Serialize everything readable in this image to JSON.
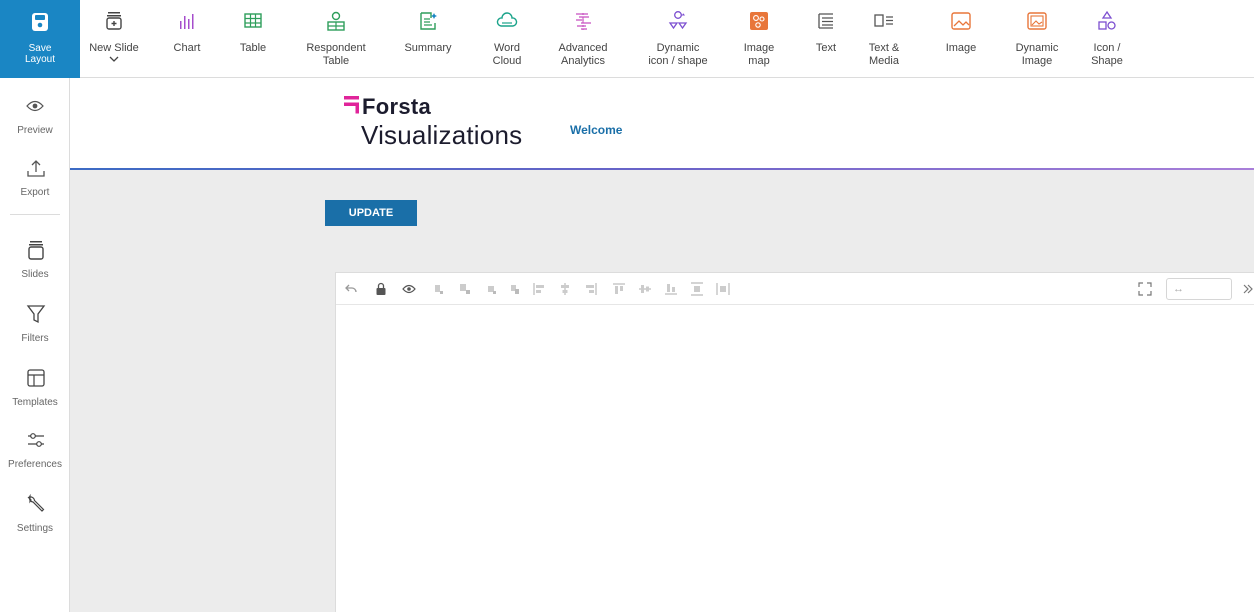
{
  "toolbar": {
    "save_label": "Save\nLayout",
    "items": [
      {
        "label": "New Slide",
        "icon": "new-slide-icon"
      },
      {
        "label": "Chart",
        "icon": "chart-icon"
      },
      {
        "label": "Table",
        "icon": "table-icon"
      },
      {
        "label": "Respondent\nTable",
        "icon": "respondent-table-icon"
      },
      {
        "label": "Summary",
        "icon": "summary-icon"
      },
      {
        "label": "Word\nCloud",
        "icon": "word-cloud-icon"
      },
      {
        "label": "Advanced\nAnalytics",
        "icon": "advanced-analytics-icon"
      },
      {
        "label": "Dynamic\nicon / shape",
        "icon": "dynamic-shape-icon"
      },
      {
        "label": "Image\nmap",
        "icon": "image-map-icon"
      },
      {
        "label": "Text",
        "icon": "text-icon"
      },
      {
        "label": "Text &\nMedia",
        "icon": "text-media-icon"
      },
      {
        "label": "Image",
        "icon": "image-icon"
      },
      {
        "label": "Dynamic\nImage",
        "icon": "dynamic-image-icon"
      },
      {
        "label": "Icon /\nShape",
        "icon": "icon-shape-icon"
      }
    ]
  },
  "sidebar": {
    "items": [
      {
        "label": "Preview",
        "icon": "eye-icon"
      },
      {
        "label": "Export",
        "icon": "export-icon"
      },
      {
        "label": "Slides",
        "icon": "slides-icon"
      },
      {
        "label": "Filters",
        "icon": "filter-icon"
      },
      {
        "label": "Templates",
        "icon": "templates-icon"
      },
      {
        "label": "Preferences",
        "icon": "preferences-icon"
      },
      {
        "label": "Settings",
        "icon": "wrench-icon"
      }
    ]
  },
  "header": {
    "brand": "Forsta",
    "product": "Visualizations",
    "welcome": "Welcome"
  },
  "main": {
    "update_label": "UPDATE"
  },
  "canvas": {
    "size_placeholder": "↔"
  },
  "colors": {
    "accent": "#1a86c4",
    "link": "#1a6fa8",
    "brand_magenta": "#e0249a",
    "chart_purple": "#a64dcc",
    "table_green": "#2e9e5b",
    "orange": "#e8763a"
  }
}
